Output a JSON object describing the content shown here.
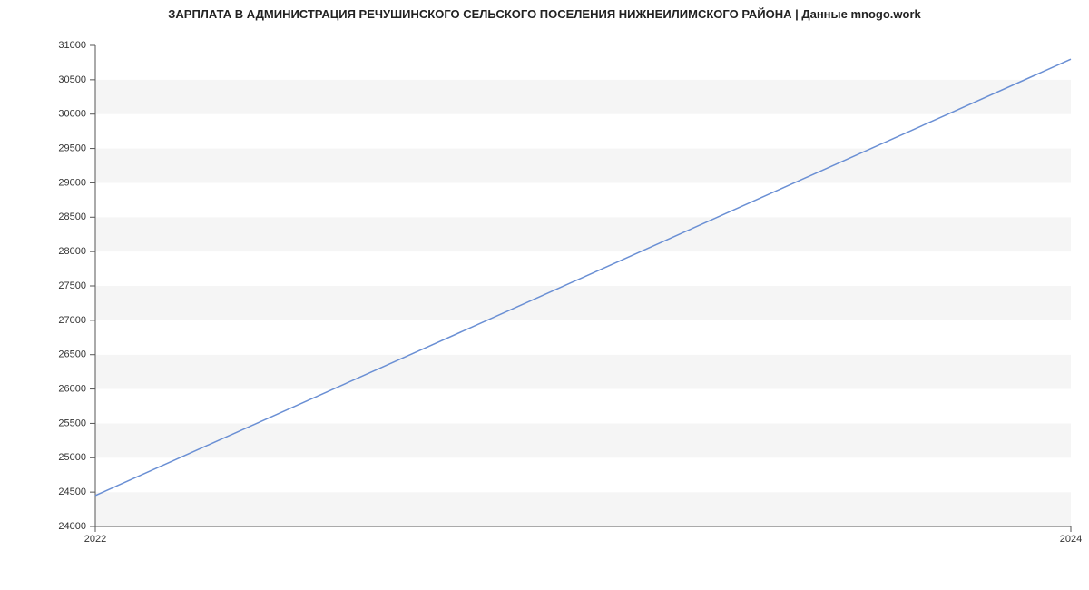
{
  "chart_data": {
    "type": "line",
    "title": "ЗАРПЛАТА В АДМИНИСТРАЦИЯ РЕЧУШИНСКОГО СЕЛЬСКОГО ПОСЕЛЕНИЯ НИЖНЕИЛИМСКОГО РАЙОНА | Данные mnogo.work",
    "x": [
      2022,
      2024
    ],
    "values": [
      24450,
      30800
    ],
    "x_ticks": [
      2022,
      2024
    ],
    "y_ticks": [
      24000,
      24500,
      25000,
      25500,
      26000,
      26500,
      27000,
      27500,
      28000,
      28500,
      29000,
      29500,
      30000,
      30500,
      31000
    ],
    "xlim": [
      2022,
      2024
    ],
    "ylim": [
      24000,
      31000
    ],
    "xlabel": "",
    "ylabel": ""
  }
}
